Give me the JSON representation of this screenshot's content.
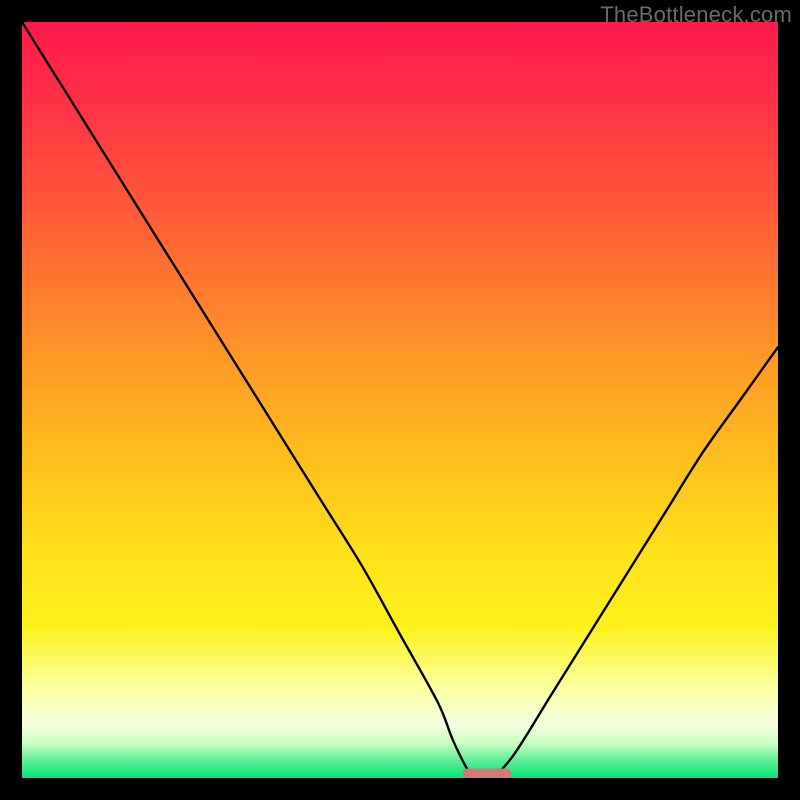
{
  "watermark": "TheBottleneck.com",
  "chart_data": {
    "type": "line",
    "title": "",
    "xlabel": "",
    "ylabel": "",
    "xlim": [
      0,
      100
    ],
    "ylim": [
      0,
      100
    ],
    "gradient_stops": [
      {
        "offset": 0.0,
        "color": "#ff1a4b"
      },
      {
        "offset": 0.1,
        "color": "#ff2f47"
      },
      {
        "offset": 0.25,
        "color": "#ff5a38"
      },
      {
        "offset": 0.4,
        "color": "#ff8a2a"
      },
      {
        "offset": 0.55,
        "color": "#ffb71e"
      },
      {
        "offset": 0.7,
        "color": "#ffe01a"
      },
      {
        "offset": 0.8,
        "color": "#fff21c"
      },
      {
        "offset": 0.88,
        "color": "#fbffa0"
      },
      {
        "offset": 0.93,
        "color": "#f4ffe0"
      },
      {
        "offset": 0.955,
        "color": "#c7ffbf"
      },
      {
        "offset": 0.975,
        "color": "#66f09a"
      },
      {
        "offset": 1.0,
        "color": "#00e37a"
      }
    ],
    "series": [
      {
        "name": "bottleneck-curve",
        "x": [
          0,
          5,
          10,
          15,
          20,
          25,
          30,
          35,
          40,
          45,
          50,
          55,
          57,
          59,
          60,
          62,
          65,
          70,
          75,
          80,
          85,
          90,
          95,
          100
        ],
        "values": [
          100,
          92,
          84,
          76,
          68,
          60,
          52,
          44,
          36,
          28,
          19,
          10,
          5,
          1,
          0,
          0,
          3,
          11,
          19,
          27,
          35,
          43,
          50,
          57
        ]
      }
    ],
    "marker": {
      "name": "optimal-range-marker",
      "x_center": 61.5,
      "y": 0.6,
      "width": 6.5,
      "height": 1.3,
      "color": "#d17a76"
    }
  }
}
